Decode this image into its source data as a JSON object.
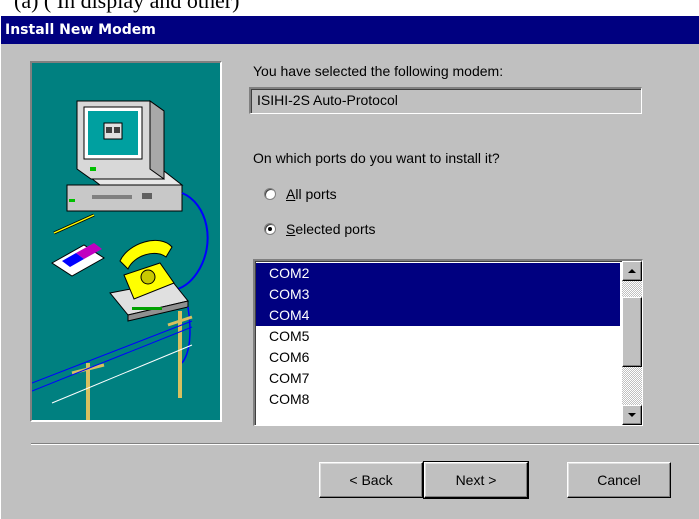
{
  "window": {
    "title": "Install New Modem"
  },
  "top_fragment": "(a) ( In display and other)",
  "selected_modem": {
    "label": "You have selected the following modem:",
    "value": "ISIHI-2S Auto-Protocol"
  },
  "ports": {
    "question": "On which ports do you want to install it?",
    "options": [
      {
        "label": "All ports",
        "checked": false
      },
      {
        "label": "Selected ports",
        "checked": true
      }
    ]
  },
  "port_list": {
    "items": [
      {
        "label": "COM2",
        "selected": true
      },
      {
        "label": "COM3",
        "selected": true
      },
      {
        "label": "COM4",
        "selected": true
      },
      {
        "label": "COM5",
        "selected": false,
        "focused": true
      },
      {
        "label": "COM6",
        "selected": false
      },
      {
        "label": "COM7",
        "selected": false
      },
      {
        "label": "COM8",
        "selected": false
      }
    ]
  },
  "buttons": {
    "back": "< Back",
    "next": "Next >",
    "cancel": "Cancel"
  },
  "colors": {
    "title_bar": "#000080",
    "dialog_face": "#c0c0c0",
    "illustration_bg": "#008080",
    "selection": "#000080"
  }
}
